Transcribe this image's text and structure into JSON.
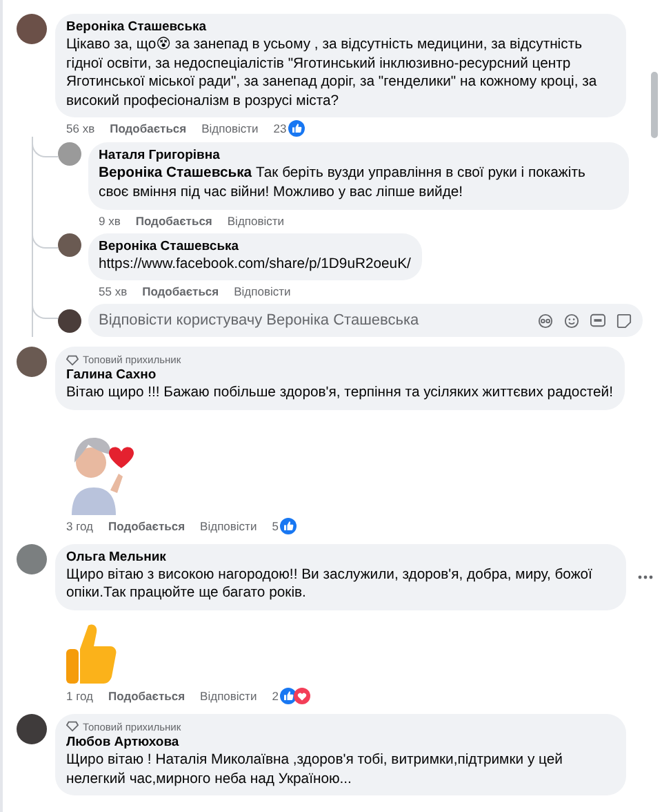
{
  "comments": [
    {
      "author": "Вероніка Сташевська",
      "body": [
        {
          "kind": "text",
          "text": "Цікаво за, що😵 за занепад в усьому , за відсутність медицини, за відсутність гідної освіти, за недоспеціалістів \"Яготинський інклюзивно-ресурсний центр Яготинської міської ради\", за занепад доріг, за \"генделики\" на кожному кроці, за високий професіоналізм в розрусі міста?"
        }
      ],
      "time": "56 хв",
      "like": "Подобається",
      "reply": "Відповісти",
      "reaction_count": "23",
      "reactions": [
        {
          "kind": "like"
        }
      ],
      "replies": [
        {
          "author": "Наталя Григорівна",
          "body": [
            {
              "kind": "text",
              "text": "**Вероніка Сташевська** Так беріть вузди управління в свої руки і покажіть своє вміння під час війни! Можливо у вас ліпше вийде!"
            }
          ],
          "time": "9 хв",
          "like": "Подобається",
          "reply": "Відповісти"
        },
        {
          "author": "Вероніка Сташевська",
          "body": [
            {
              "kind": "link",
              "text": "https://www.facebook.com/share/p/1D9uR2oeuK/"
            }
          ],
          "time": "55 хв",
          "like": "Подобається",
          "reply": "Відповісти"
        }
      ],
      "reply_box": {
        "placeholder": "Відповісти користувачу Вероніка Сташевська"
      }
    },
    {
      "author": "Галина Сахно",
      "badge": "Топовий прихильник",
      "body": [
        {
          "kind": "text",
          "text": "Вітаю щиро !!! Бажаю побільше здоров'я, терпіння та усіляких життєвих радостей!"
        }
      ],
      "sticker": {
        "kind": "heart"
      },
      "time": "3 год",
      "like": "Подобається",
      "reply": "Відповісти",
      "reaction_count": "5",
      "reactions": [
        {
          "kind": "like"
        }
      ]
    },
    {
      "author": "Ольга Мельник",
      "body": [
        {
          "kind": "text",
          "text": "Щиро вітаю з високою нагородою!! Ви заслужили, здоров'я, добра, миру, божої опіки.Так працюйте ще багато років."
        }
      ],
      "menu": true,
      "sticker": {
        "kind": "thumbs"
      },
      "time": "1 год",
      "like": "Подобається",
      "reply": "Відповісти",
      "reaction_count": "2",
      "reactions": [
        {
          "kind": "like"
        },
        {
          "kind": "love"
        }
      ]
    },
    {
      "author": "Любов Артюхова",
      "badge": "Топовий прихильник",
      "body": [
        {
          "kind": "text",
          "text": "Щиро вітаю ! Наталія Миколаївна ,здоров'я тобі, витримки,підтримки у цей нелегкий час,мирного неба над Україною..."
        }
      ]
    }
  ]
}
